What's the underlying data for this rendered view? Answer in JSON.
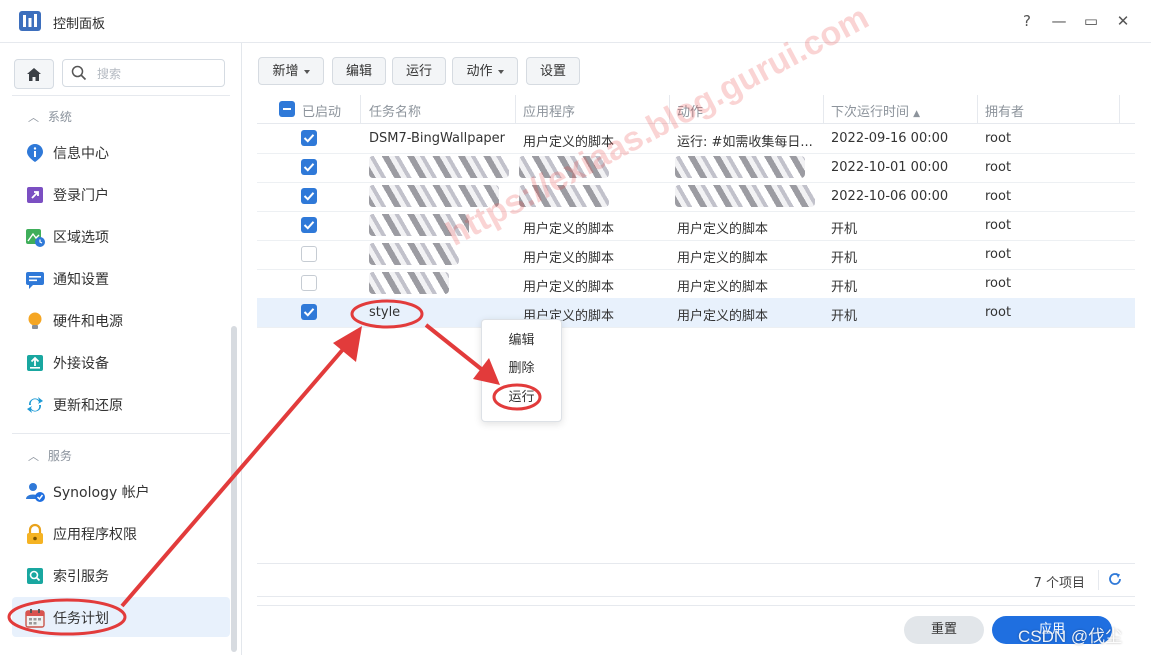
{
  "window": {
    "title": "控制面板",
    "help": "?",
    "minimize": "—",
    "maximize": "▭",
    "close": "✕"
  },
  "sidebar": {
    "search_placeholder": "搜索",
    "sections": [
      {
        "title": "系统",
        "items": [
          "信息中心",
          "登录门户",
          "区域选项",
          "通知设置",
          "硬件和电源",
          "外接设备",
          "更新和还原"
        ]
      },
      {
        "title": "服务",
        "items": [
          "Synology 帐户",
          "应用程序权限",
          "索引服务",
          "任务计划"
        ]
      }
    ],
    "active_item": "任务计划"
  },
  "toolbar": {
    "create": "新增",
    "edit": "编辑",
    "run": "运行",
    "action": "动作",
    "settings": "设置"
  },
  "table": {
    "columns": [
      "已启动",
      "任务名称",
      "应用程序",
      "动作",
      "下次运行时间",
      "拥有者"
    ],
    "rows": [
      {
        "enabled": true,
        "name": "DSM7-BingWallpaper",
        "app": "用户定义的脚本",
        "action": "运行: #如需收集每日...",
        "next": "2022-09-16 00:00",
        "owner": "root"
      },
      {
        "enabled": true,
        "name": "",
        "app": "",
        "action": "",
        "next": "2022-10-01 00:00",
        "owner": "root"
      },
      {
        "enabled": true,
        "name": "",
        "app": "",
        "action": "",
        "next": "2022-10-06 00:00",
        "owner": "root"
      },
      {
        "enabled": true,
        "name": "",
        "app": "用户定义的脚本",
        "action": "用户定义的脚本",
        "next": "开机",
        "owner": "root"
      },
      {
        "enabled": false,
        "name": "",
        "app": "用户定义的脚本",
        "action": "用户定义的脚本",
        "next": "开机",
        "owner": "root"
      },
      {
        "enabled": false,
        "name": "",
        "app": "用户定义的脚本",
        "action": "用户定义的脚本",
        "next": "开机",
        "owner": "root"
      },
      {
        "enabled": true,
        "name": "style",
        "app": "用户定义的脚本",
        "action": "用户定义的脚本",
        "next": "开机",
        "owner": "root"
      }
    ],
    "count": "7 个项目"
  },
  "context_menu": {
    "items": [
      "编辑",
      "删除",
      "运行"
    ]
  },
  "footer": {
    "reset": "重置",
    "apply": "应用"
  },
  "watermark": "https://exiaas.blog.gurui.com",
  "credit": "CSDN @伐尘",
  "colors": {
    "accent": "#2f79d8",
    "annotation": "#e23b3b"
  }
}
